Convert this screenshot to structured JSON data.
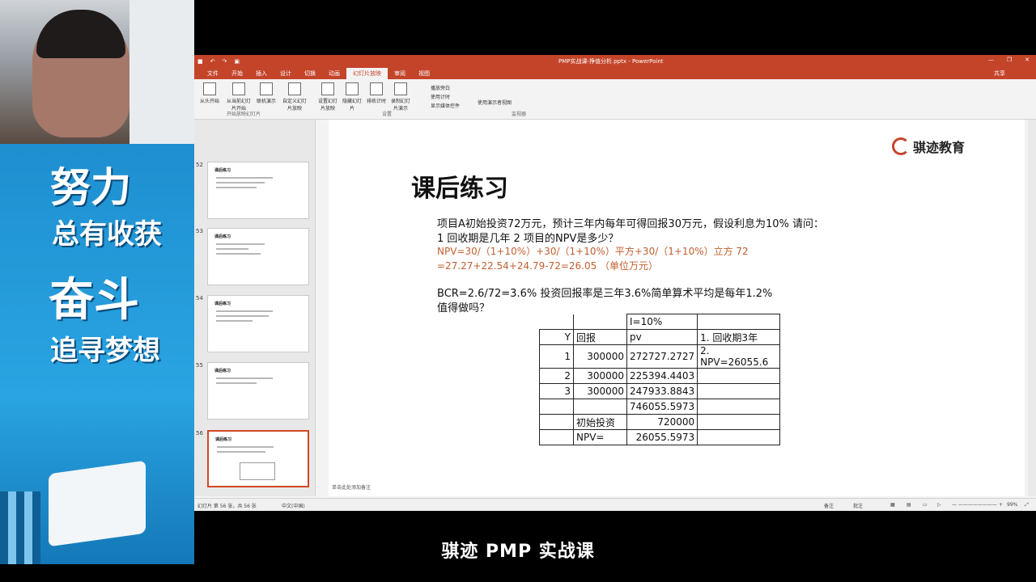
{
  "window": {
    "title": "PMP实战课-挣值分析.pptx - PowerPoint",
    "quick_access": [
      "save-icon",
      "undo-icon",
      "redo-icon",
      "present-icon"
    ],
    "share": "共享"
  },
  "ribbon": {
    "tabs": [
      "文件",
      "开始",
      "插入",
      "设计",
      "切换",
      "动画",
      "幻灯片放映",
      "审阅",
      "视图"
    ],
    "active_tab": "幻灯片放映",
    "buttons": [
      "从头开始",
      "从当前幻灯片开始",
      "联机演示",
      "自定义幻灯片放映",
      "设置幻灯片放映",
      "隐藏幻灯片",
      "排练计时",
      "录制幻灯片演示"
    ],
    "checks": [
      "播放旁白",
      "使用计时",
      "显示媒体控件"
    ],
    "presenter": "使用演示者视图",
    "groups": [
      "开始放映幻灯片",
      "设置",
      "监视器"
    ]
  },
  "thumbnails": [
    {
      "num": "52",
      "title": "课后练习"
    },
    {
      "num": "53",
      "title": "课后练习"
    },
    {
      "num": "54",
      "title": "课后练习"
    },
    {
      "num": "55",
      "title": "课后练习"
    },
    {
      "num": "56",
      "title": "课后练习"
    }
  ],
  "slide": {
    "logo": "骐迹教育",
    "title": "课后练习",
    "lines": [
      "项目A初始投资72万元，预计三年内每年可得回报30万元，假设利息为10% 请问：",
      "1 回收期是几年 2 项目的NPV是多少？",
      "NPV=30/（1+10%）+30/（1+10%）平方+30/（1+10%）立方 72",
      "=27.27+22.54+24.79-72=26.05 （单位万元）",
      "BCR=2.6/72=3.6% 投资回报率是三年3.6%简单算术平均是每年1.2%",
      "值得做吗？"
    ],
    "table": {
      "rate": "I=10%",
      "header": [
        "Y",
        "回报",
        "pv",
        "1. 回收期3年"
      ],
      "rows": [
        [
          "1",
          "300000",
          "272727.2727",
          "2. NPV=26055.6"
        ],
        [
          "2",
          "300000",
          "225394.4403",
          ""
        ],
        [
          "3",
          "300000",
          "247933.8843",
          ""
        ]
      ],
      "total": "746055.5973",
      "initial_label": "初始投资",
      "initial_value": "720000",
      "npv_label": "NPV=",
      "npv_value": "26055.5973"
    }
  },
  "notes": "单击此处添加备注",
  "status": {
    "slide_info": "幻灯片 第 56 张，共 56 张",
    "lang": "中文(中国)",
    "notes_btn": "备注",
    "comments_btn": "批注",
    "zoom": "99%"
  },
  "banner": {
    "line1": "努力",
    "line2": "总有收获",
    "line3": "奋斗",
    "line4": "追寻梦想"
  },
  "caption": "骐迹 PMP 实战课",
  "colors": {
    "accent": "#c4442a",
    "banner": "#2aa4e2"
  }
}
